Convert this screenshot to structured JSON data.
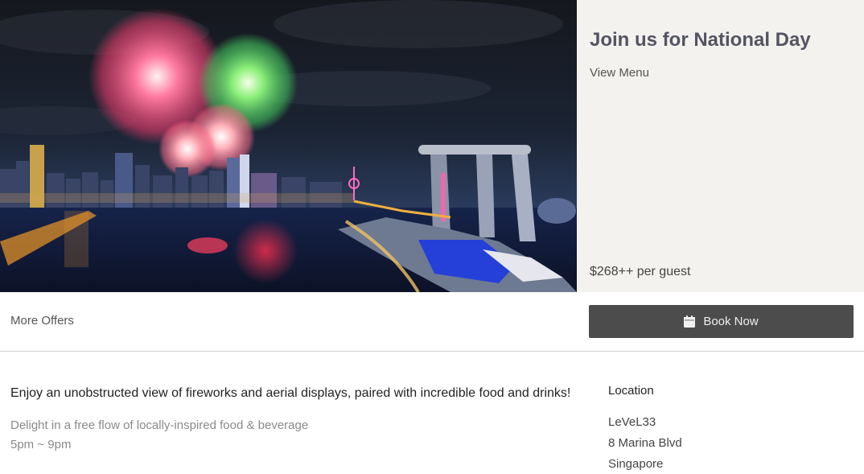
{
  "offer": {
    "title": "Join us for National Day",
    "view_menu": "View Menu",
    "price": "$268++ per guest"
  },
  "actions": {
    "more_offers": "More Offers",
    "book_now": "Book Now"
  },
  "description": {
    "main": "Enjoy an unobstructed view of fireworks and aerial displays, paired with incredible food and drinks!",
    "sub": "Delight in a free flow of locally-inspired food & beverage",
    "time": "5pm ~ 9pm"
  },
  "location": {
    "heading": "Location",
    "lines": [
      "LeVeL33",
      "8 Marina Blvd",
      "Singapore"
    ]
  },
  "icons": {
    "book": "calendar-icon"
  },
  "colors": {
    "panel_bg": "#f3f2ef",
    "title": "#545463",
    "button_bg": "#4c4c4c"
  }
}
